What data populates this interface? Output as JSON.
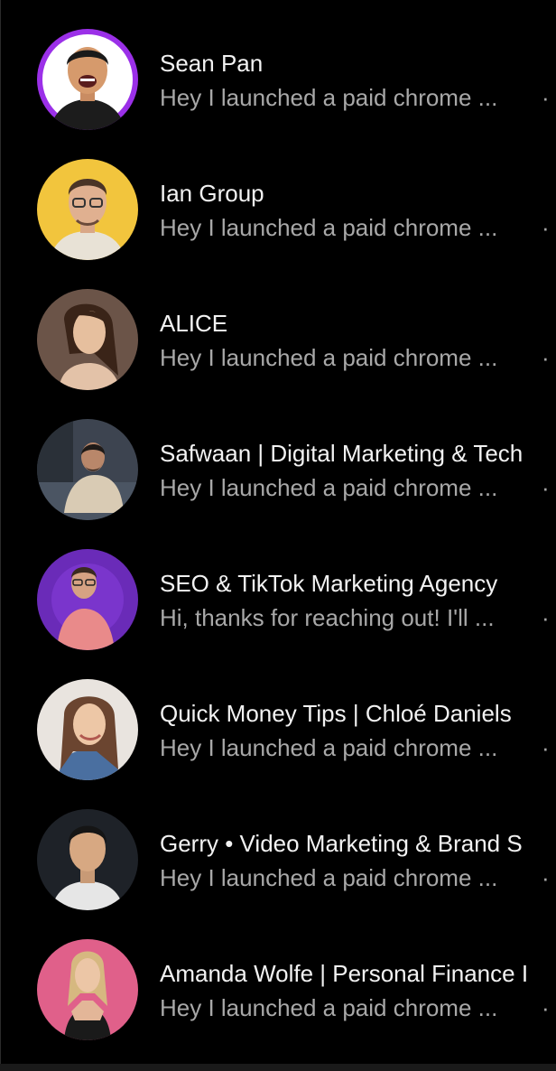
{
  "conversations": [
    {
      "name": "Sean Pan",
      "preview": "Hey I launched a paid chrome ...",
      "separator": "·",
      "avatar_bg": "#9b30e8",
      "avatar_icon": "person-avatar-icon"
    },
    {
      "name": "Ian Group",
      "preview": "Hey I launched a paid chrome ...",
      "separator": "·",
      "avatar_bg": "#f2c53d",
      "avatar_icon": "person-avatar-icon"
    },
    {
      "name": "ALICE",
      "preview": "Hey I launched a paid chrome ...",
      "separator": "·",
      "avatar_bg": "#6b5448",
      "avatar_icon": "person-avatar-icon"
    },
    {
      "name": "Safwaan | Digital Marketing & Tech",
      "preview": "Hey I launched a paid chrome ...",
      "separator": "·",
      "avatar_bg": "#3d4450",
      "avatar_icon": "person-avatar-icon"
    },
    {
      "name": "SEO & TikTok Marketing Agency",
      "preview": "Hi, thanks for reaching out! I'll ...",
      "separator": "·",
      "avatar_bg": "#6a2bb8",
      "avatar_icon": "person-avatar-icon"
    },
    {
      "name": "Quick Money Tips | Chloé Daniels",
      "preview": "Hey I launched a paid chrome ...",
      "separator": "·",
      "avatar_bg": "#e9e4df",
      "avatar_icon": "person-avatar-icon"
    },
    {
      "name": "Gerry • Video Marketing & Brand S",
      "preview": "Hey I launched a paid chrome ...",
      "separator": "·",
      "avatar_bg": "#1e2228",
      "avatar_icon": "person-avatar-icon"
    },
    {
      "name": "Amanda Wolfe | Personal Finance I",
      "preview": "Hey I launched a paid chrome ...",
      "separator": "·",
      "avatar_bg": "#e0608a",
      "avatar_icon": "person-avatar-icon"
    }
  ]
}
